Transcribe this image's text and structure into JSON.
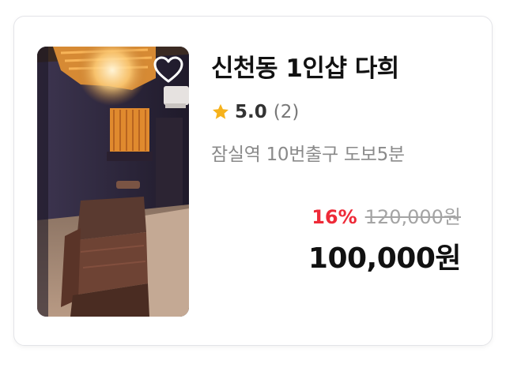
{
  "listing": {
    "title": "신천동 1인샵 다희",
    "rating_score": "5.0",
    "rating_count": "(2)",
    "location": "잠실역 10번출구 도보5분",
    "discount": "16%",
    "original_price": "120,000원",
    "price": "100,000원",
    "image": "massage-room-photo",
    "favorite_icon": "heart-outline-icon",
    "rating_icon": "star-icon"
  },
  "colors": {
    "discount": "#ee2a38",
    "star": "#f6b21b",
    "card_border": "#e3e4e8",
    "title": "#111111",
    "muted": "#8a8a8a"
  }
}
